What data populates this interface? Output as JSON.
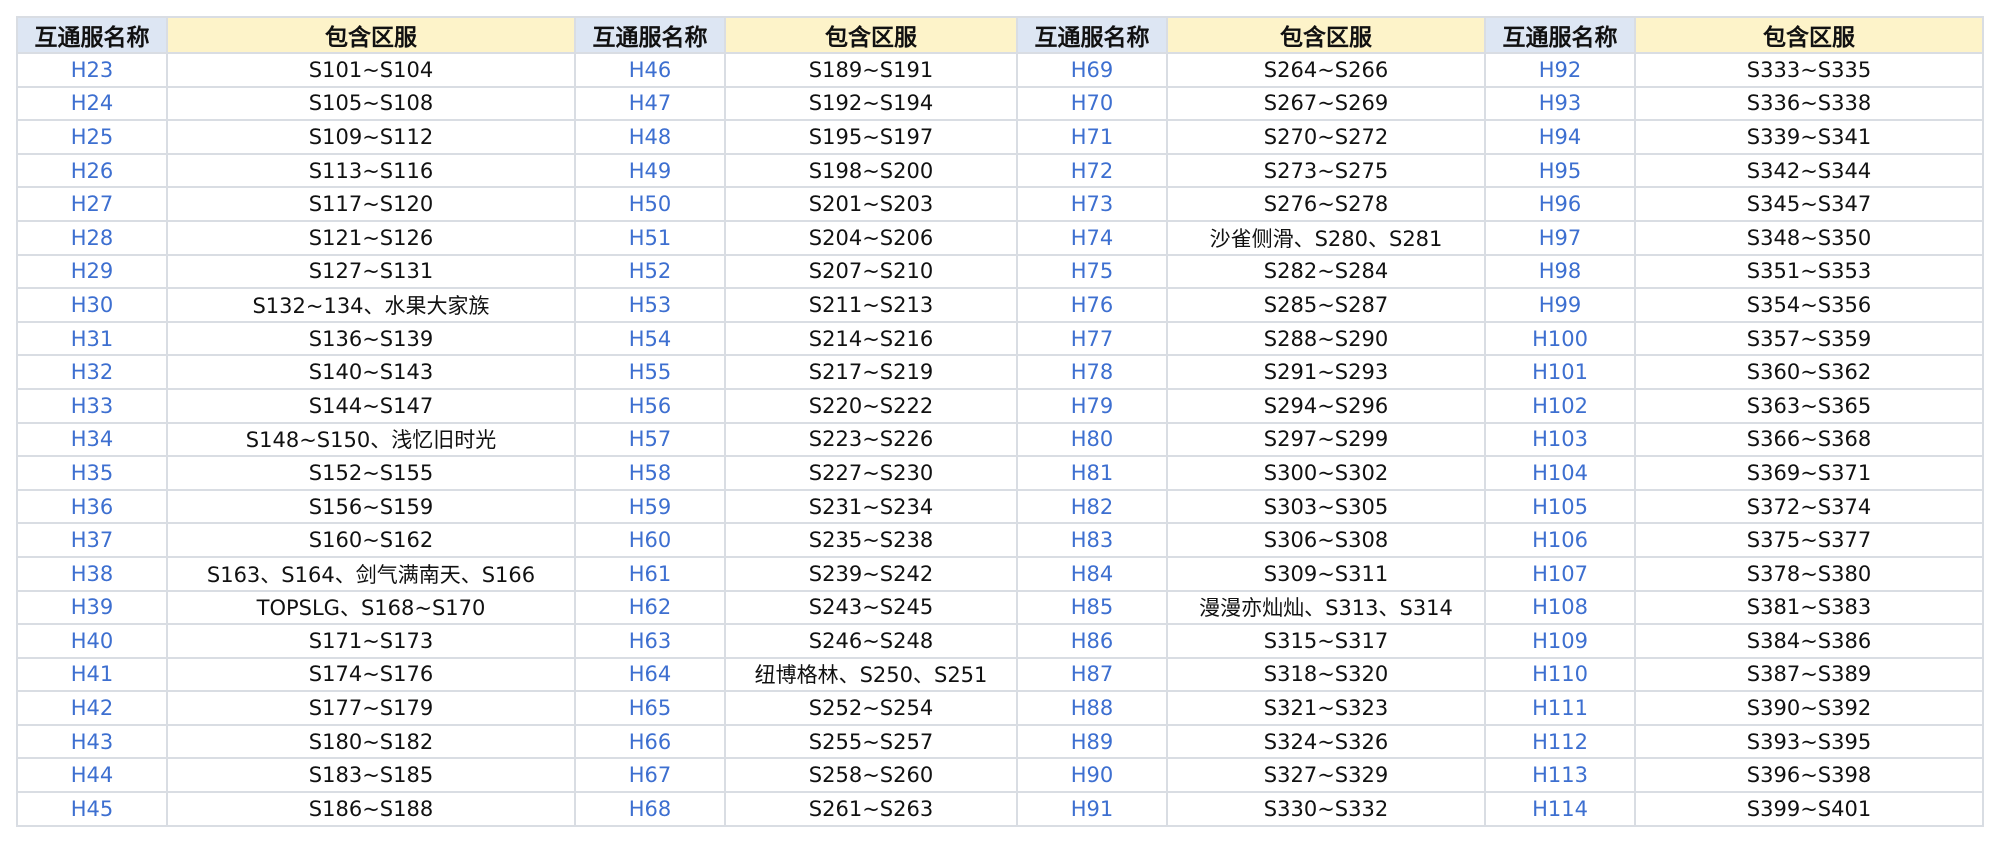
{
  "headers": {
    "name": "互通服名称",
    "range": "包含区服"
  },
  "groups": [
    {
      "rows": [
        {
          "name": "H23",
          "range": "S101~S104"
        },
        {
          "name": "H24",
          "range": "S105~S108"
        },
        {
          "name": "H25",
          "range": "S109~S112"
        },
        {
          "name": "H26",
          "range": "S113~S116"
        },
        {
          "name": "H27",
          "range": "S117~S120"
        },
        {
          "name": "H28",
          "range": "S121~S126"
        },
        {
          "name": "H29",
          "range": "S127~S131"
        },
        {
          "name": "H30",
          "range": "S132~134、水果大家族"
        },
        {
          "name": "H31",
          "range": "S136~S139"
        },
        {
          "name": "H32",
          "range": "S140~S143"
        },
        {
          "name": "H33",
          "range": "S144~S147"
        },
        {
          "name": "H34",
          "range": "S148~S150、浅忆旧时光"
        },
        {
          "name": "H35",
          "range": "S152~S155"
        },
        {
          "name": "H36",
          "range": "S156~S159"
        },
        {
          "name": "H37",
          "range": "S160~S162"
        },
        {
          "name": "H38",
          "range": "S163、S164、剑气满南天、S166"
        },
        {
          "name": "H39",
          "range": "TOPSLG、S168~S170"
        },
        {
          "name": "H40",
          "range": "S171~S173"
        },
        {
          "name": "H41",
          "range": "S174~S176"
        },
        {
          "name": "H42",
          "range": "S177~S179"
        },
        {
          "name": "H43",
          "range": "S180~S182"
        },
        {
          "name": "H44",
          "range": "S183~S185"
        },
        {
          "name": "H45",
          "range": "S186~S188"
        }
      ]
    },
    {
      "rows": [
        {
          "name": "H46",
          "range": "S189~S191"
        },
        {
          "name": "H47",
          "range": "S192~S194"
        },
        {
          "name": "H48",
          "range": "S195~S197"
        },
        {
          "name": "H49",
          "range": "S198~S200"
        },
        {
          "name": "H50",
          "range": "S201~S203"
        },
        {
          "name": "H51",
          "range": "S204~S206"
        },
        {
          "name": "H52",
          "range": "S207~S210"
        },
        {
          "name": "H53",
          "range": "S211~S213"
        },
        {
          "name": "H54",
          "range": "S214~S216"
        },
        {
          "name": "H55",
          "range": "S217~S219"
        },
        {
          "name": "H56",
          "range": "S220~S222"
        },
        {
          "name": "H57",
          "range": "S223~S226"
        },
        {
          "name": "H58",
          "range": "S227~S230"
        },
        {
          "name": "H59",
          "range": "S231~S234"
        },
        {
          "name": "H60",
          "range": "S235~S238"
        },
        {
          "name": "H61",
          "range": "S239~S242"
        },
        {
          "name": "H62",
          "range": "S243~S245"
        },
        {
          "name": "H63",
          "range": "S246~S248"
        },
        {
          "name": "H64",
          "range": "纽博格林、S250、S251"
        },
        {
          "name": "H65",
          "range": "S252~S254"
        },
        {
          "name": "H66",
          "range": "S255~S257"
        },
        {
          "name": "H67",
          "range": "S258~S260"
        },
        {
          "name": "H68",
          "range": "S261~S263"
        }
      ]
    },
    {
      "rows": [
        {
          "name": "H69",
          "range": "S264~S266"
        },
        {
          "name": "H70",
          "range": "S267~S269"
        },
        {
          "name": "H71",
          "range": "S270~S272"
        },
        {
          "name": "H72",
          "range": "S273~S275"
        },
        {
          "name": "H73",
          "range": "S276~S278"
        },
        {
          "name": "H74",
          "range": "沙雀侧滑、S280、S281"
        },
        {
          "name": "H75",
          "range": "S282~S284"
        },
        {
          "name": "H76",
          "range": "S285~S287"
        },
        {
          "name": "H77",
          "range": "S288~S290"
        },
        {
          "name": "H78",
          "range": "S291~S293"
        },
        {
          "name": "H79",
          "range": "S294~S296"
        },
        {
          "name": "H80",
          "range": "S297~S299"
        },
        {
          "name": "H81",
          "range": "S300~S302"
        },
        {
          "name": "H82",
          "range": "S303~S305"
        },
        {
          "name": "H83",
          "range": "S306~S308"
        },
        {
          "name": "H84",
          "range": "S309~S311"
        },
        {
          "name": "H85",
          "range": "漫漫亦灿灿、S313、S314"
        },
        {
          "name": "H86",
          "range": "S315~S317"
        },
        {
          "name": "H87",
          "range": "S318~S320"
        },
        {
          "name": "H88",
          "range": "S321~S323"
        },
        {
          "name": "H89",
          "range": "S324~S326"
        },
        {
          "name": "H90",
          "range": "S327~S329"
        },
        {
          "name": "H91",
          "range": "S330~S332"
        }
      ]
    },
    {
      "rows": [
        {
          "name": "H92",
          "range": "S333~S335"
        },
        {
          "name": "H93",
          "range": "S336~S338"
        },
        {
          "name": "H94",
          "range": "S339~S341"
        },
        {
          "name": "H95",
          "range": "S342~S344"
        },
        {
          "name": "H96",
          "range": "S345~S347"
        },
        {
          "name": "H97",
          "range": "S348~S350"
        },
        {
          "name": "H98",
          "range": "S351~S353"
        },
        {
          "name": "H99",
          "range": "S354~S356"
        },
        {
          "name": "H100",
          "range": "S357~S359"
        },
        {
          "name": "H101",
          "range": "S360~S362"
        },
        {
          "name": "H102",
          "range": "S363~S365"
        },
        {
          "name": "H103",
          "range": "S366~S368"
        },
        {
          "name": "H104",
          "range": "S369~S371"
        },
        {
          "name": "H105",
          "range": "S372~S374"
        },
        {
          "name": "H106",
          "range": "S375~S377"
        },
        {
          "name": "H107",
          "range": "S378~S380"
        },
        {
          "name": "H108",
          "range": "S381~S383"
        },
        {
          "name": "H109",
          "range": "S384~S386"
        },
        {
          "name": "H110",
          "range": "S387~S389"
        },
        {
          "name": "H111",
          "range": "S390~S392"
        },
        {
          "name": "H112",
          "range": "S393~S395"
        },
        {
          "name": "H113",
          "range": "S396~S398"
        },
        {
          "name": "H114",
          "range": "S399~S401"
        }
      ]
    }
  ]
}
